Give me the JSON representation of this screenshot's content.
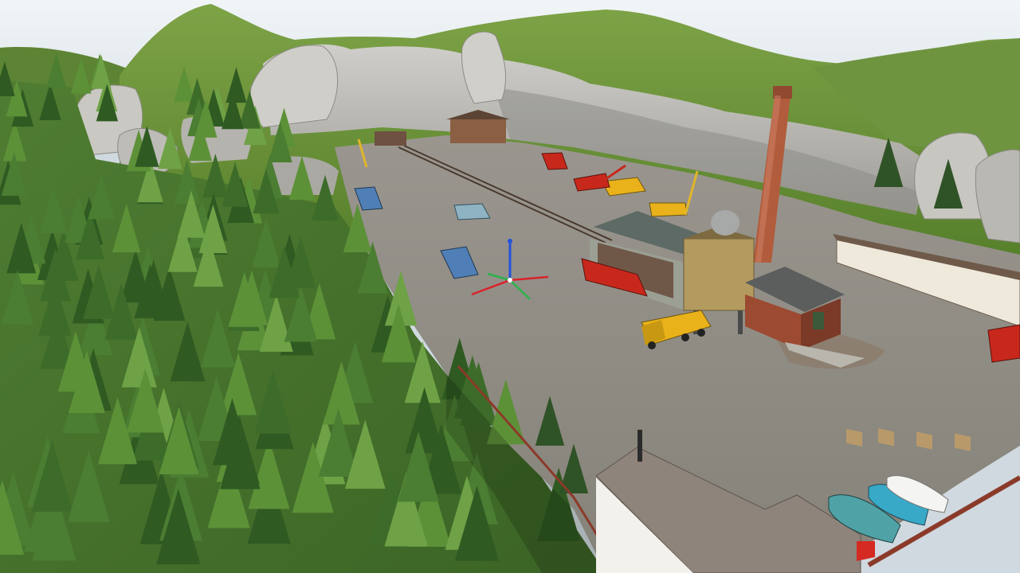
{
  "scene": {
    "kind": "3d-editor-viewport",
    "subject": "quarry-railway-diorama",
    "colors": {
      "sky": "#e9eef2",
      "grass": "#6f9a3a",
      "rock": "#b9b8b2",
      "gravel": "#8f8c86",
      "forest": "#3f6a2a",
      "truck_yellow": "#e9b21a",
      "truck_red": "#c8281c",
      "truck_blue": "#4f7fb6",
      "gizmo_x": "#d8232a",
      "gizmo_y": "#2bb34a",
      "gizmo_z": "#2452d8"
    },
    "objects": [
      {
        "name": "chimney",
        "icon": "chimney-icon"
      },
      {
        "name": "crusher-tower"
      },
      {
        "name": "loading-shed"
      },
      {
        "name": "brick-engine-house"
      },
      {
        "name": "storage-sheds-row"
      },
      {
        "name": "mine-buildings"
      },
      {
        "name": "office-building-foreground"
      },
      {
        "name": "parked-cars"
      },
      {
        "name": "dump-trucks"
      },
      {
        "name": "cranes"
      },
      {
        "name": "rail-track"
      }
    ],
    "gizmo": {
      "axes": [
        "x",
        "y",
        "z"
      ],
      "icon": "transform-gizmo-icon"
    }
  }
}
